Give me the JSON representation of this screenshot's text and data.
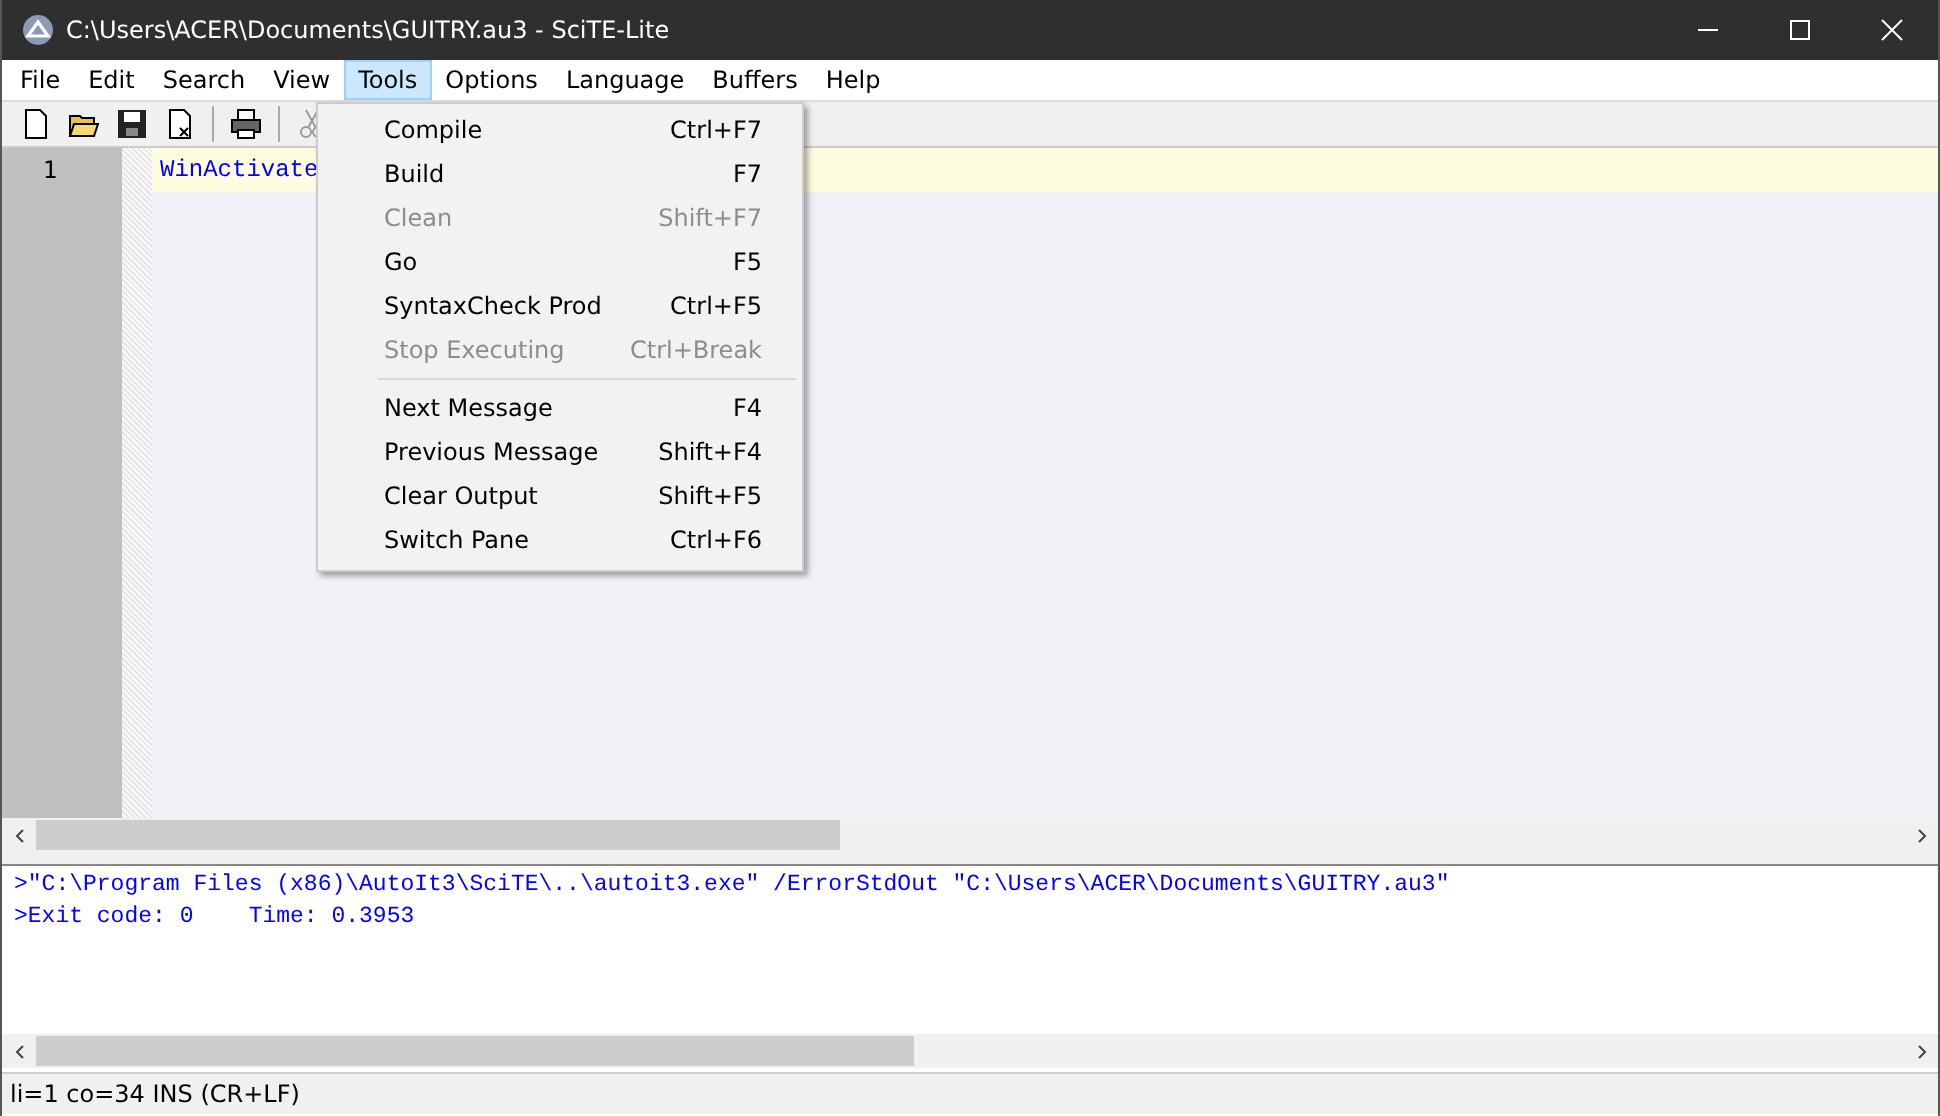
{
  "window": {
    "title": "C:\\Users\\ACER\\Documents\\GUITRY.au3 - SciTE-Lite"
  },
  "menu_bar": [
    {
      "label": "File",
      "selected": false
    },
    {
      "label": "Edit",
      "selected": false
    },
    {
      "label": "Search",
      "selected": false
    },
    {
      "label": "View",
      "selected": false
    },
    {
      "label": "Tools",
      "selected": true
    },
    {
      "label": "Options",
      "selected": false
    },
    {
      "label": "Language",
      "selected": false
    },
    {
      "label": "Buffers",
      "selected": false
    },
    {
      "label": "Help",
      "selected": false
    }
  ],
  "toolbar": [
    {
      "kind": "new",
      "disabled": false
    },
    {
      "kind": "open",
      "disabled": false
    },
    {
      "kind": "save",
      "disabled": false
    },
    {
      "kind": "close",
      "disabled": false
    },
    {
      "kind": "separator"
    },
    {
      "kind": "print",
      "disabled": false
    },
    {
      "kind": "separator"
    },
    {
      "kind": "cut",
      "disabled": true
    }
  ],
  "editor": {
    "lines": [
      {
        "number": "1",
        "text": "WinActivate",
        "current": true
      }
    ]
  },
  "tools_menu": [
    {
      "kind": "item",
      "label": "Compile",
      "shortcut": "Ctrl+F7",
      "disabled": false
    },
    {
      "kind": "item",
      "label": "Build",
      "shortcut": "F7",
      "disabled": false
    },
    {
      "kind": "item",
      "label": "Clean",
      "shortcut": "Shift+F7",
      "disabled": true
    },
    {
      "kind": "item",
      "label": "Go",
      "shortcut": "F5",
      "disabled": false
    },
    {
      "kind": "item",
      "label": "SyntaxCheck Prod",
      "shortcut": "Ctrl+F5",
      "disabled": false
    },
    {
      "kind": "item",
      "label": "Stop Executing",
      "shortcut": "Ctrl+Break",
      "disabled": true
    },
    {
      "kind": "separator"
    },
    {
      "kind": "item",
      "label": "Next Message",
      "shortcut": "F4",
      "disabled": false
    },
    {
      "kind": "item",
      "label": "Previous Message",
      "shortcut": "Shift+F4",
      "disabled": false
    },
    {
      "kind": "item",
      "label": "Clear Output",
      "shortcut": "Shift+F5",
      "disabled": false
    },
    {
      "kind": "item",
      "label": "Switch Pane",
      "shortcut": "Ctrl+F6",
      "disabled": false
    }
  ],
  "output": {
    "lines": [
      ">\"C:\\Program Files (x86)\\AutoIt3\\SciTE\\..\\autoit3.exe\" /ErrorStdOut \"C:\\Users\\ACER\\Documents\\GUITRY.au3\"",
      ">Exit code: 0    Time: 0.3953"
    ]
  },
  "status_bar": {
    "text": "li=1 co=34 INS (CR+LF)"
  }
}
